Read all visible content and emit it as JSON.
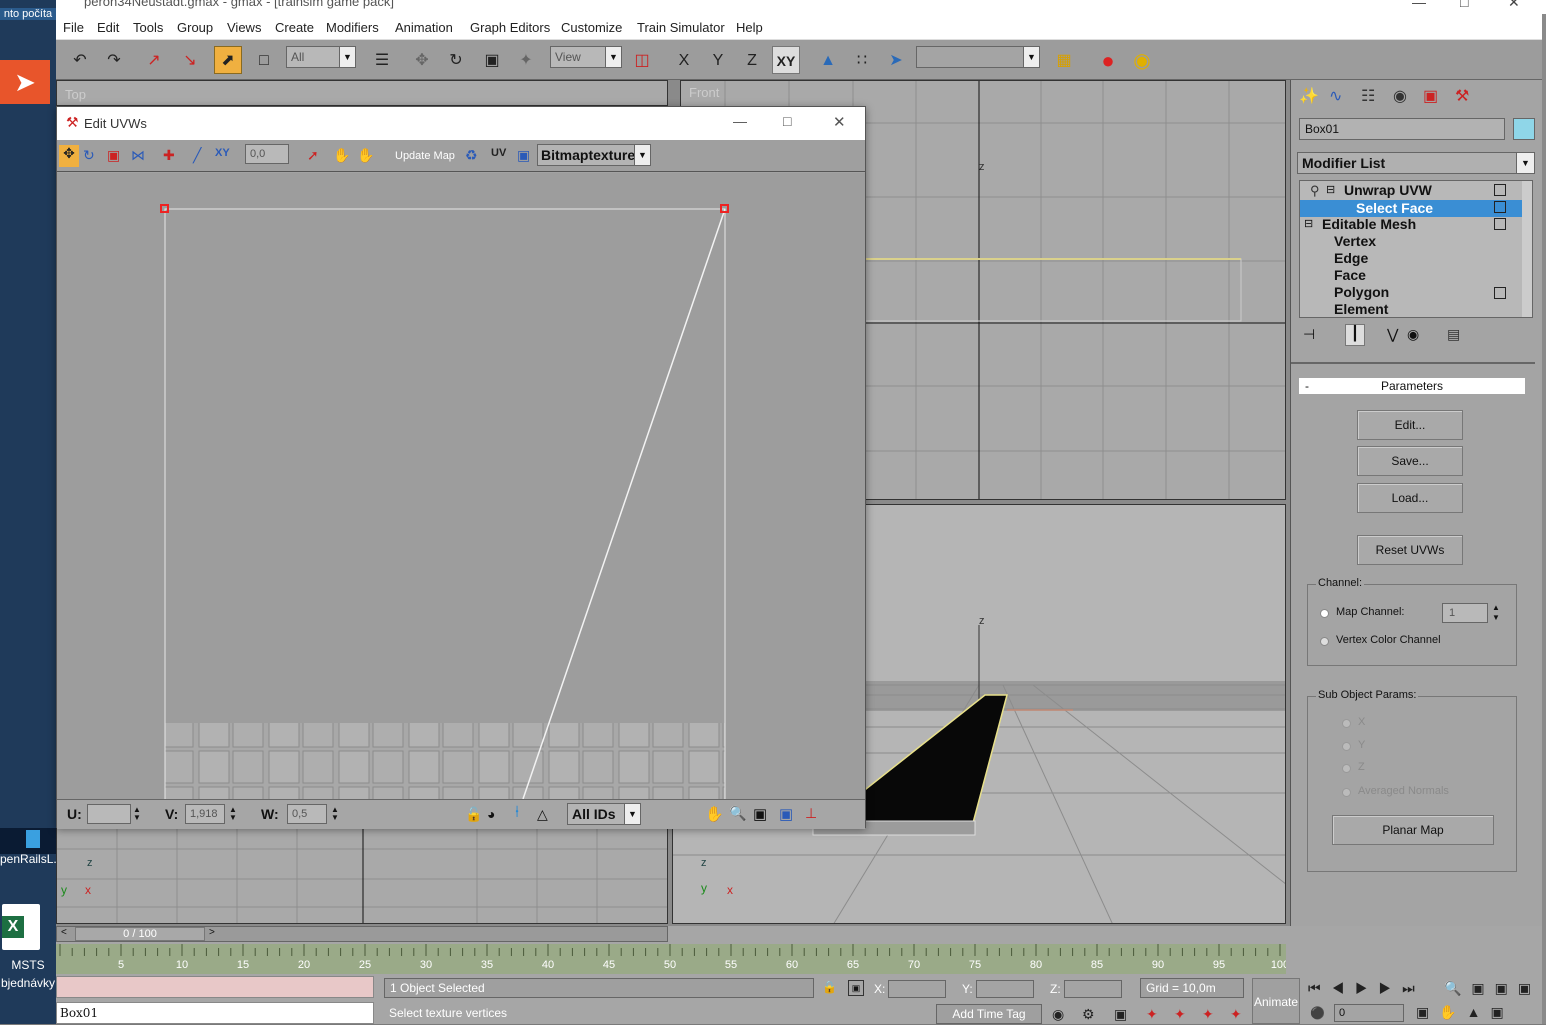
{
  "window": {
    "title": "peron34Neustadt.gmax - gmax - [trainsim game pack]"
  },
  "menu": [
    "File",
    "Edit",
    "Tools",
    "Group",
    "Views",
    "Create",
    "Modifiers",
    "Animation",
    "Graph Editors",
    "Customize",
    "Train Simulator",
    "Help"
  ],
  "toolbar": {
    "selection_filter": "All",
    "coord_system": "View",
    "axis_x": "X",
    "axis_y": "Y",
    "axis_z": "Z",
    "axis_xy": "XY"
  },
  "desktop": {
    "icon1_label": "nto počíta",
    "icon2_label": "penRailsL..",
    "icon3_label": "MSTS",
    "icon3_sub": "bjednávky"
  },
  "viewports": {
    "top_label": "Top",
    "front_label": "Front",
    "axis_z": "z",
    "axis_y": "y",
    "axis_x": "x"
  },
  "uvw": {
    "title": "Edit UVWs",
    "spinner_value": "0,0",
    "update_map": "Update Map",
    "uv_label": "UV",
    "texture_select": "Bitmaptexture",
    "u_label": "U:",
    "u_value": "",
    "v_label": "V:",
    "v_value": "1,918",
    "w_label": "W:",
    "w_value": "0,5",
    "ids_select": "All IDs"
  },
  "command_panel": {
    "object_name": "Box01",
    "color": "#8fd6e8",
    "modifier_list": "Modifier List",
    "stack": [
      {
        "label": "Unwrap UVW",
        "indent": 0
      },
      {
        "label": "Select Face",
        "indent": 1,
        "selected": true
      },
      {
        "label": "Editable Mesh",
        "indent": 0
      },
      {
        "label": "Vertex",
        "indent": 1
      },
      {
        "label": "Edge",
        "indent": 1
      },
      {
        "label": "Face",
        "indent": 1
      },
      {
        "label": "Polygon",
        "indent": 1
      },
      {
        "label": "Element",
        "indent": 1
      }
    ],
    "rollout": "Parameters",
    "rollout_sign": "-",
    "buttons": {
      "edit": "Edit...",
      "save": "Save...",
      "load": "Load...",
      "reset": "Reset UVWs",
      "planar": "Planar Map"
    },
    "channel_group": "Channel:",
    "map_channel": "Map Channel:",
    "map_channel_value": "1",
    "vertex_color_channel": "Vertex Color Channel",
    "subobj_group": "Sub Object Params:",
    "sub_x": "X",
    "sub_y": "Y",
    "sub_z": "Z",
    "sub_avg": "Averaged Normals"
  },
  "timeline": {
    "frame": "0 / 100",
    "ticks": [
      "5",
      "10",
      "15",
      "20",
      "25",
      "30",
      "35",
      "40",
      "45",
      "50",
      "55",
      "60",
      "65",
      "70",
      "75",
      "80",
      "85",
      "90",
      "95",
      "100"
    ]
  },
  "status": {
    "name_field": "Box01",
    "selected": "1 Object Selected",
    "prompt": "Select texture vertices",
    "x_label": "X:",
    "y_label": "Y:",
    "z_label": "Z:",
    "grid": "Grid = 10,0m",
    "add_time_tag": "Add Time Tag",
    "animate": "Animate",
    "frame_value": "0"
  }
}
